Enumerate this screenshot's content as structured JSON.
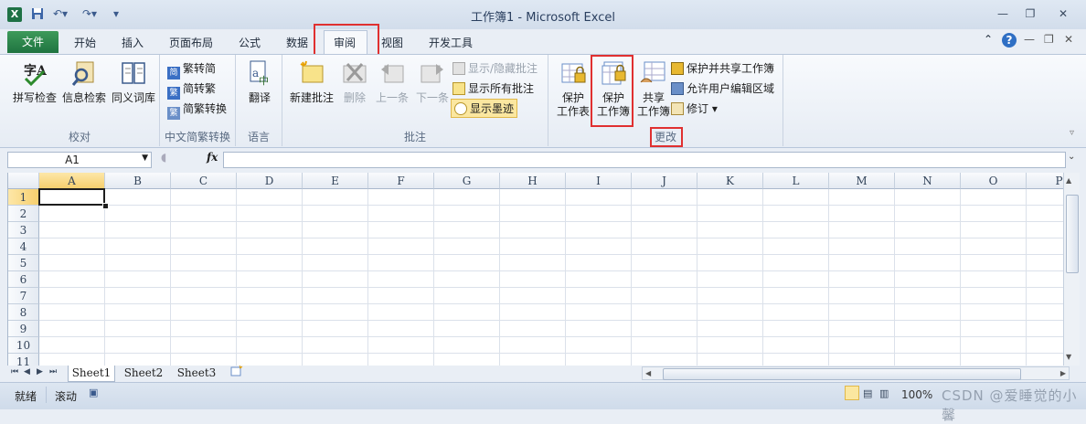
{
  "window": {
    "title": "工作簿1 - Microsoft Excel",
    "app_icon": "X"
  },
  "tabs": {
    "file": "文件",
    "items": [
      "开始",
      "插入",
      "页面布局",
      "公式",
      "数据",
      "审阅",
      "视图",
      "开发工具"
    ],
    "active": "审阅"
  },
  "ribbon": {
    "proofing": {
      "label": "校对",
      "spell": "拼写检查",
      "research": "信息检索",
      "thesaurus": "同义词库"
    },
    "chinese": {
      "label": "中文简繁转换",
      "to_trad": "繁转简",
      "to_simp": "简转繁",
      "convert": "简繁转换"
    },
    "language": {
      "label": "语言",
      "translate": "翻译"
    },
    "comments": {
      "label": "批注",
      "new": "新建批注",
      "delete": "删除",
      "prev": "上一条",
      "next": "下一条",
      "show_hide": "显示/隐藏批注",
      "show_all": "显示所有批注",
      "show_ink": "显示墨迹"
    },
    "changes": {
      "label": "更改",
      "protect_sheet_l1": "保护",
      "protect_sheet_l2": "工作表",
      "protect_wb_l1": "保护",
      "protect_wb_l2": "工作簿",
      "share_l1": "共享",
      "share_l2": "工作簿",
      "protect_share": "保护并共享工作簿",
      "allow_edit": "允许用户编辑区域",
      "track": "修订"
    }
  },
  "formula": {
    "namebox": "A1",
    "fx": "fx",
    "value": ""
  },
  "grid": {
    "columns": [
      "A",
      "B",
      "C",
      "D",
      "E",
      "F",
      "G",
      "H",
      "I",
      "J",
      "K",
      "L",
      "M",
      "N",
      "O",
      "P"
    ],
    "rows": [
      "1",
      "2",
      "3",
      "4",
      "5",
      "6",
      "7",
      "8",
      "9",
      "10",
      "11"
    ],
    "selected": "A1"
  },
  "sheets": [
    "Sheet1",
    "Sheet2",
    "Sheet3"
  ],
  "status": {
    "ready": "就绪",
    "scroll": "滚动",
    "zoom": "100%",
    "watermark": "CSDN @爱睡觉的小馨"
  },
  "colors": {
    "file_tab": "#217346",
    "highlight": "#e03030",
    "ink_button": "#fbe7a0"
  }
}
